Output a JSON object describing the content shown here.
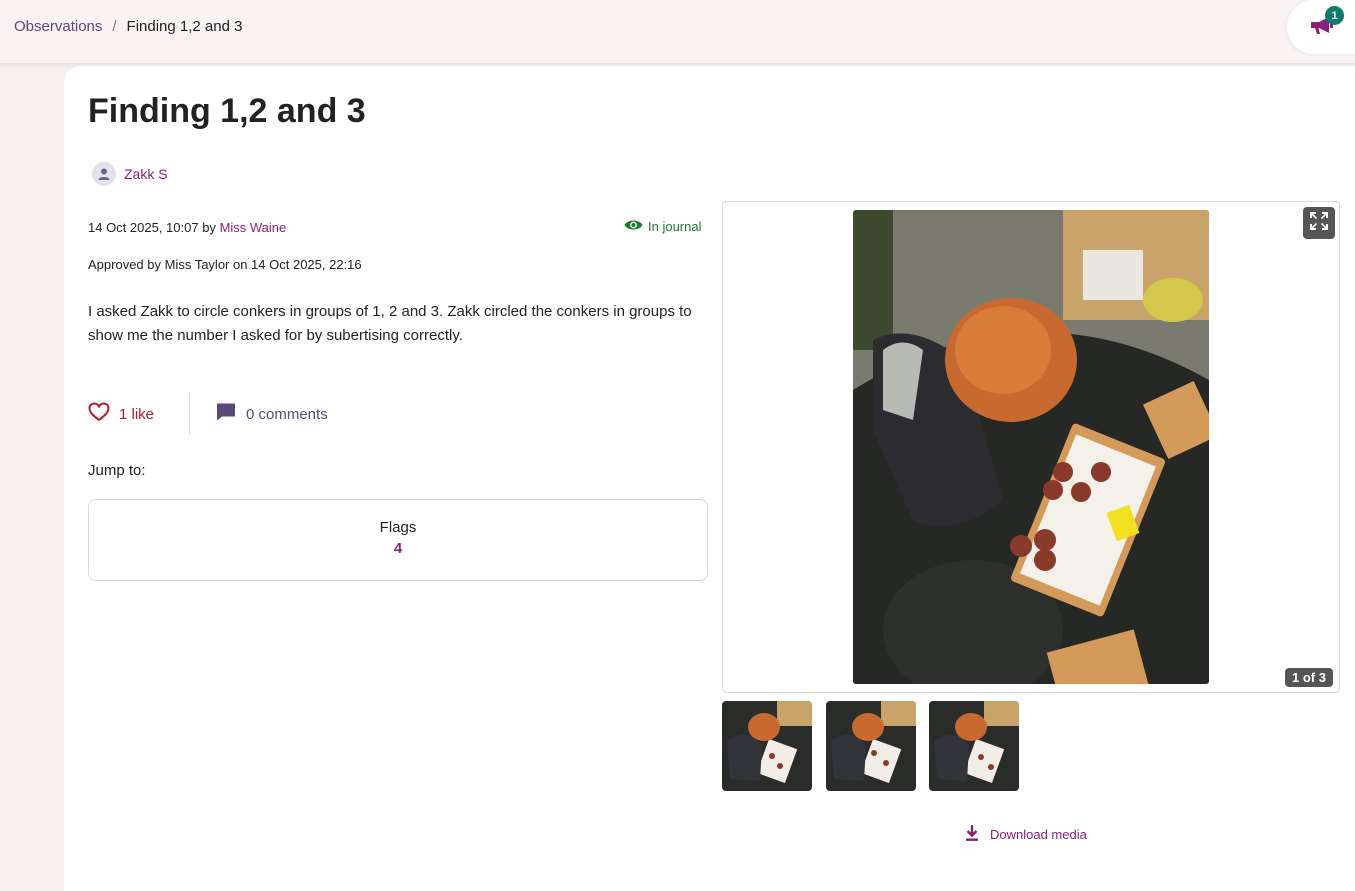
{
  "breadcrumb": {
    "parent": "Observations",
    "separator": "/",
    "current": "Finding 1,2 and 3"
  },
  "announcements": {
    "badge_count": "1",
    "icon": "megaphone-icon"
  },
  "observation": {
    "title": "Finding 1,2 and 3",
    "child_name": "Zakk S",
    "date_prefix": "14 Oct 2025, 10:07 by",
    "author": "Miss Waine",
    "journal_status": "In journal",
    "approved": "Approved by Miss Taylor on 14 Oct 2025, 22:16",
    "description": "I asked Zakk to circle conkers in groups of 1, 2 and 3. Zakk circled the conkers in groups to show me the number I asked for by subertising correctly."
  },
  "engagement": {
    "likes": "1 like",
    "comments": "0 comments"
  },
  "jump": {
    "label": "Jump to:",
    "flags_label": "Flags",
    "flags_count": "4"
  },
  "media": {
    "counter": "1 of 3",
    "download_label": "Download media"
  },
  "colors": {
    "accent": "#8a1f78",
    "nav_link": "#5a4a78",
    "journal_green": "#1e7a2e",
    "like_red": "#b01e2e",
    "badge_teal": "#0f7a6e"
  }
}
